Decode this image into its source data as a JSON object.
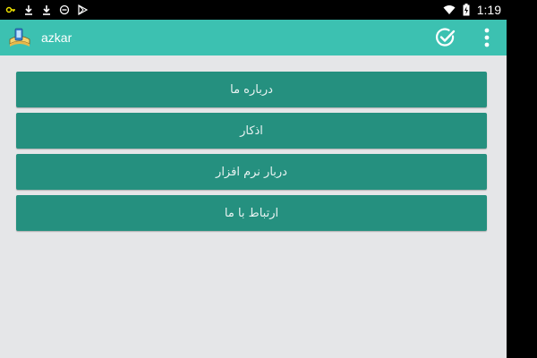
{
  "status_bar": {
    "time": "1:19",
    "left_icons": [
      "notification-key-icon",
      "download-icon",
      "download-icon",
      "minus-circle-icon",
      "play-store-icon"
    ],
    "right_icons": [
      "wifi-icon",
      "battery-charging-icon"
    ]
  },
  "app_bar": {
    "title": "azkar",
    "color": "#3cc1b1",
    "actions": [
      "check-circle-icon",
      "overflow-menu-icon"
    ]
  },
  "menu": {
    "button_color": "#25907f",
    "items": [
      {
        "label": "درباره ما"
      },
      {
        "label": "اذکار"
      },
      {
        "label": "دربار نرم افزار"
      },
      {
        "label": "ارتباط با ما"
      }
    ]
  }
}
